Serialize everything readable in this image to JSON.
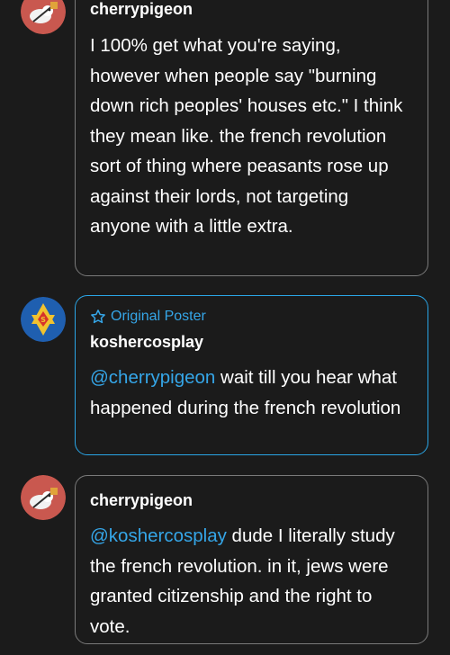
{
  "replies": [
    {
      "username": "cherrypigeon",
      "message": "I 100% get what you're saying, however when people say \"burning down rich peoples' houses etc.\" I think they mean like. the french revolution sort of thing where peasants rose up against their lords, not targeting anyone with a little extra.",
      "avatar": "cherrypigeon-avatar"
    },
    {
      "badge": "Original Poster",
      "badge_icon": "star-icon",
      "username": "koshercosplay",
      "mention": "@cherrypigeon",
      "message": " wait till you hear what happened during the french revolution",
      "avatar": "superman-star-avatar"
    },
    {
      "username": "cherrypigeon",
      "mention": "@koshercosplay",
      "message": " dude I literally study the french revolution. in it, jews were granted citizenship and the right to vote.",
      "avatar": "cherrypigeon-avatar"
    }
  ],
  "colors": {
    "background": "#1b1b1b",
    "accent": "#35a6e8",
    "bubble_border": "#7a7a7a",
    "op_border": "#2aa5e6"
  }
}
